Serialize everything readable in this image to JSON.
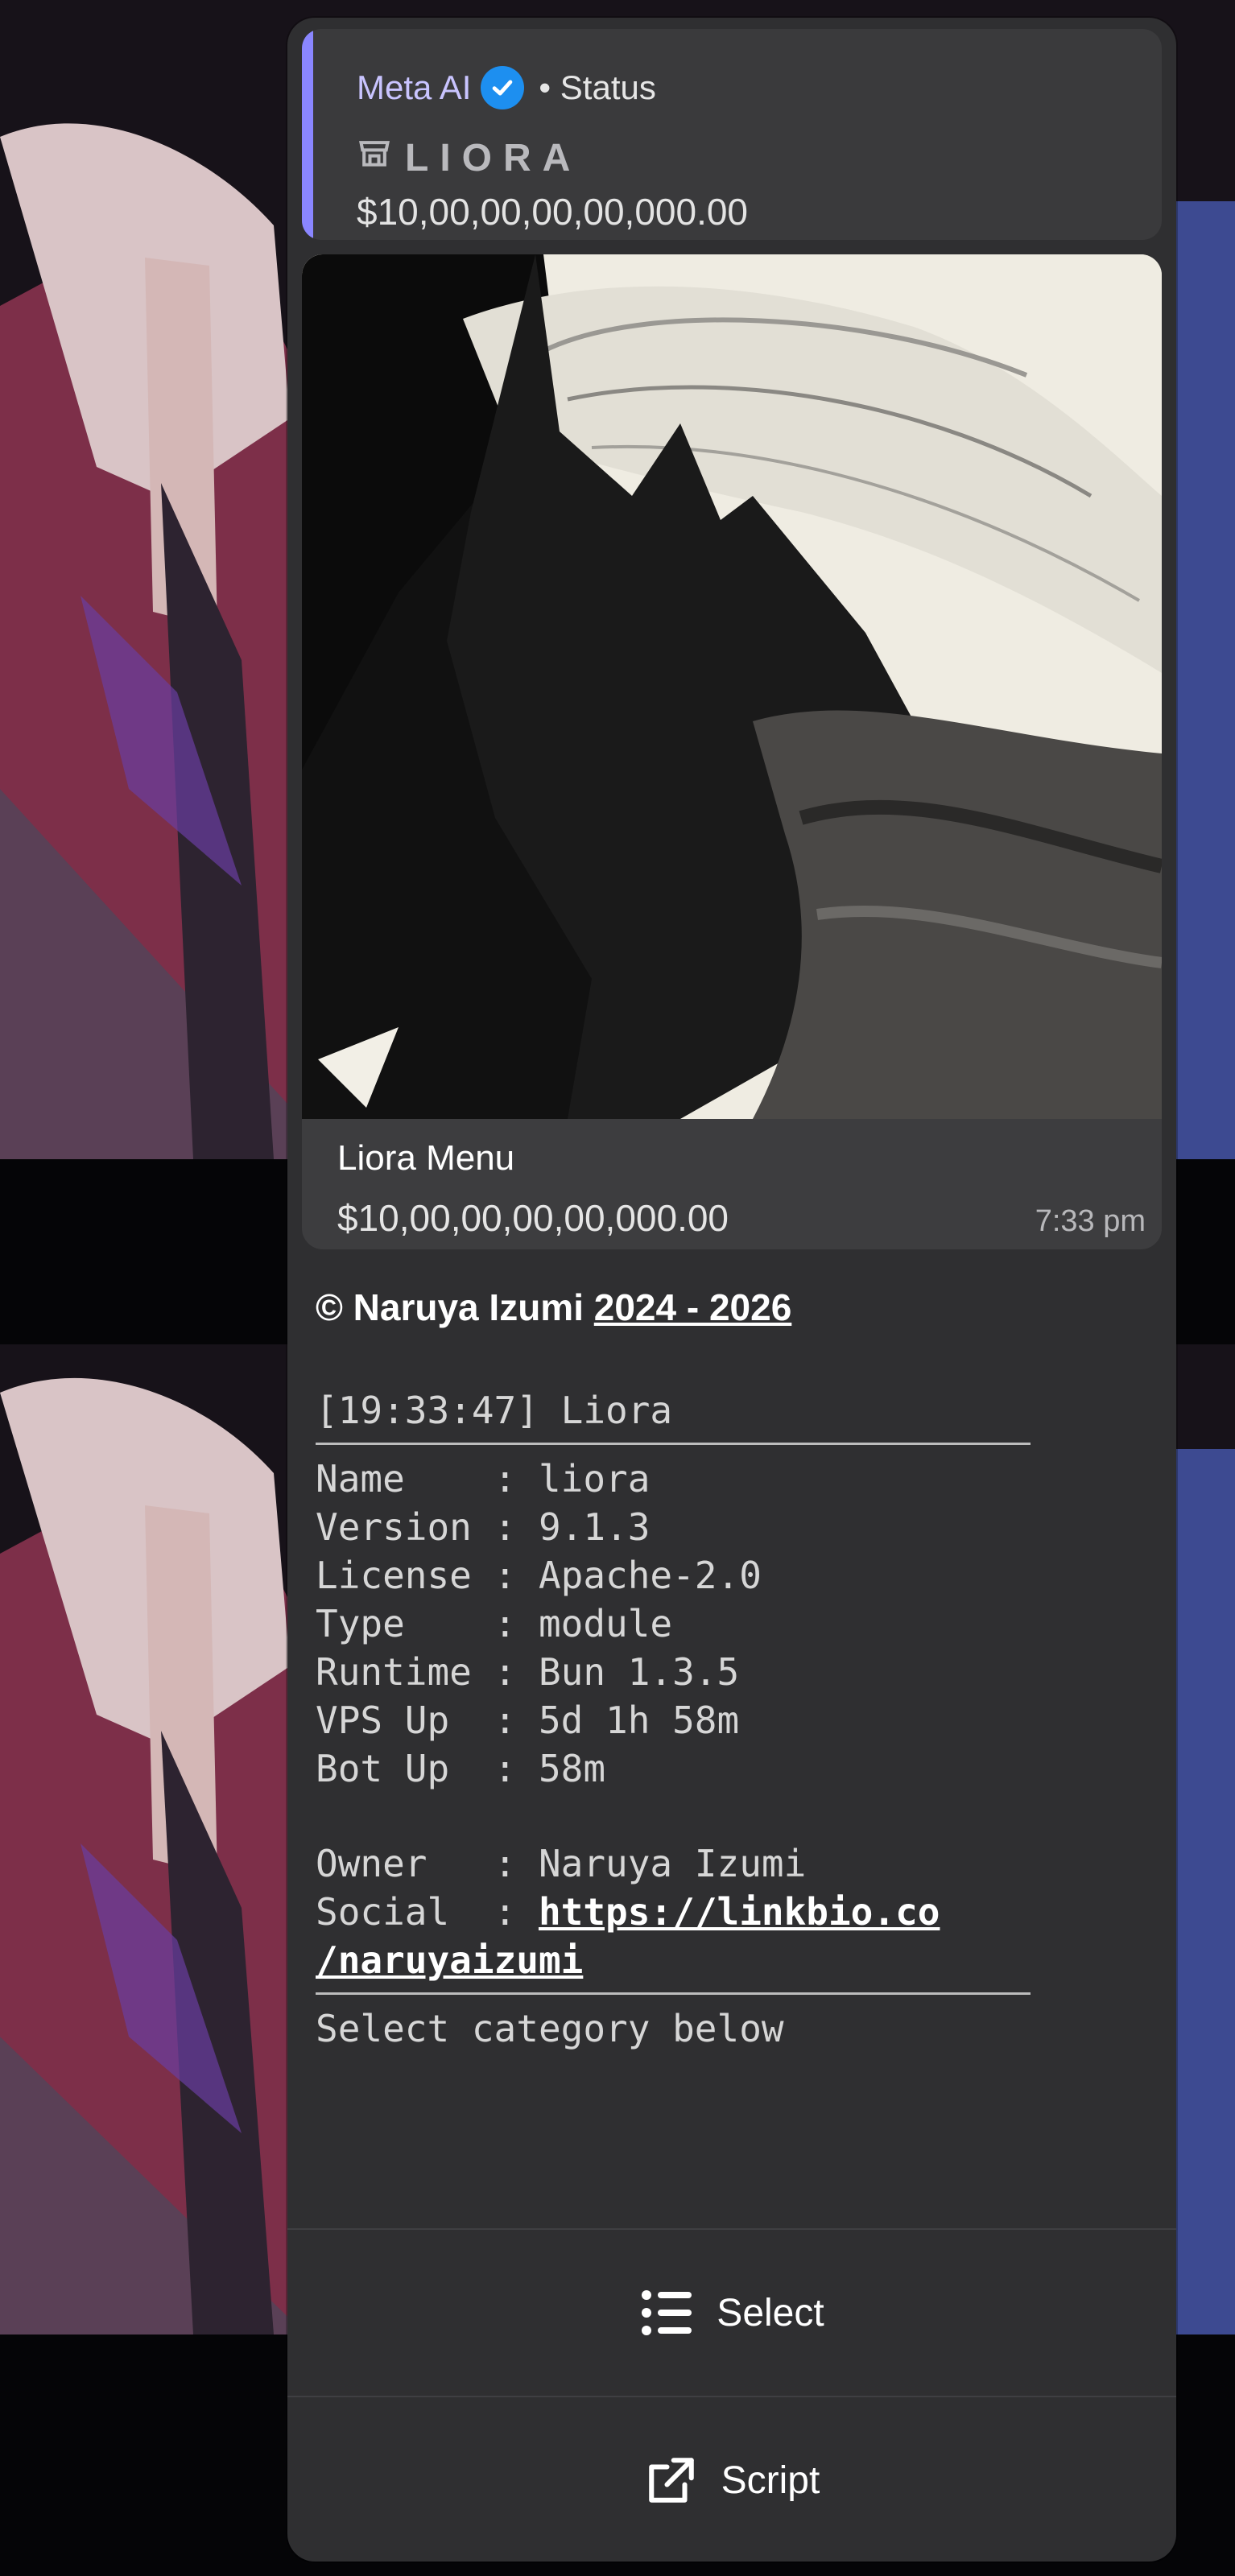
{
  "quoted": {
    "author": "Meta AI",
    "status_label": "• Status",
    "brand": "LIORA",
    "price": "$10,00,00,00,00,000.00"
  },
  "media_caption": {
    "title": "Liora Menu",
    "price": "$10,00,00,00,00,000.00",
    "time": "7:33 pm"
  },
  "copyright": {
    "prefix": "© Naruya Izumi ",
    "years": "2024 - 2026"
  },
  "terminal": {
    "header": "[19:33:47] Liora",
    "name": "Name    : liora",
    "version": "Version : 9.1.3",
    "license": "License : Apache-2.0",
    "type": "Type    : module",
    "runtime": "Runtime : Bun 1.3.5",
    "vps_up": "VPS Up  : 5d 1h 58m",
    "bot_up": "Bot Up  : 58m",
    "owner": "Owner   : Naruya Izumi",
    "social_label": "Social  : ",
    "social_link_line1": "https://linkbio.co",
    "social_link_line2": "/naruyaizumi",
    "footer": "Select category below"
  },
  "buttons": {
    "select": "Select",
    "script": "Script"
  },
  "icons": {
    "verified": "verified-badge-icon",
    "store": "store-icon",
    "list": "list-icon",
    "open_external": "open-external-icon"
  },
  "colors": {
    "accent_bar": "#8a86ff",
    "verified": "#1d8ff0",
    "bubble": "#2f2f31"
  }
}
